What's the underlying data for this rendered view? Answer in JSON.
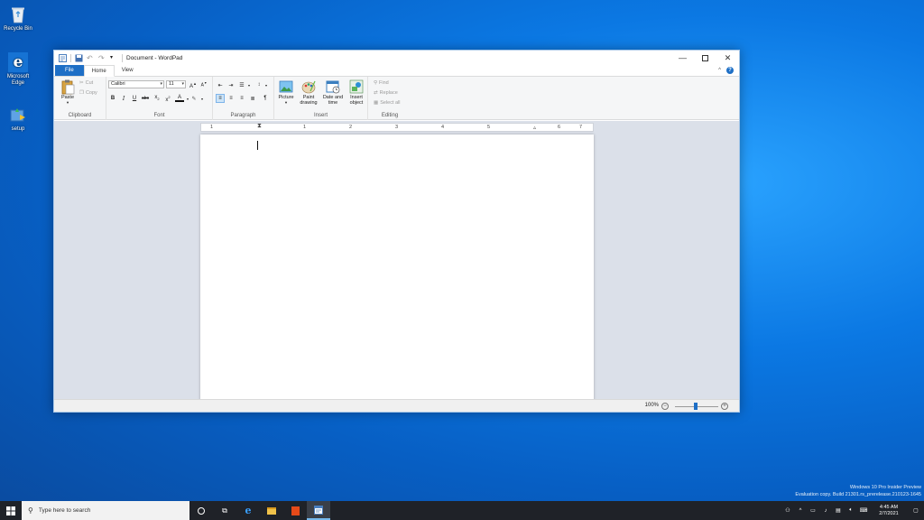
{
  "desktop": {
    "icons": [
      {
        "label": "Recycle Bin"
      },
      {
        "label": "Microsoft Edge"
      },
      {
        "label": "setup"
      }
    ]
  },
  "window": {
    "title": "Document - WordPad",
    "tabs": [
      {
        "label": "File"
      },
      {
        "label": "Home"
      },
      {
        "label": "View"
      }
    ],
    "ribbon": {
      "clipboard": {
        "paste": "Paste",
        "cut": "Cut",
        "copy": "Copy",
        "label": "Clipboard"
      },
      "font": {
        "family": "Calibri",
        "size": "11",
        "label": "Font"
      },
      "paragraph": {
        "label": "Paragraph"
      },
      "insert": {
        "picture": "Picture",
        "paint": "Paint drawing",
        "datetime": "Date and time",
        "object": "Insert object",
        "label": "Insert"
      },
      "editing": {
        "find": "Find",
        "replace": "Replace",
        "selectall": "Select all",
        "label": "Editing"
      }
    },
    "ruler_marks": [
      "1",
      "1",
      "2",
      "3",
      "4",
      "5",
      "6",
      "7"
    ],
    "status": {
      "zoom": "100%"
    }
  },
  "taskbar": {
    "search_placeholder": "Type here to search",
    "clock_time": "4:45 AM",
    "clock_date": "2/7/2021"
  },
  "watermark": {
    "line1": "Windows 10 Pro Insider Preview",
    "line2": "Evaluation copy. Build 21301.rs_prerelease.210123-1645"
  },
  "colors": {
    "accent": "#1e6fc6",
    "taskbar": "#1f2228",
    "workspace": "#dbe0e9"
  }
}
